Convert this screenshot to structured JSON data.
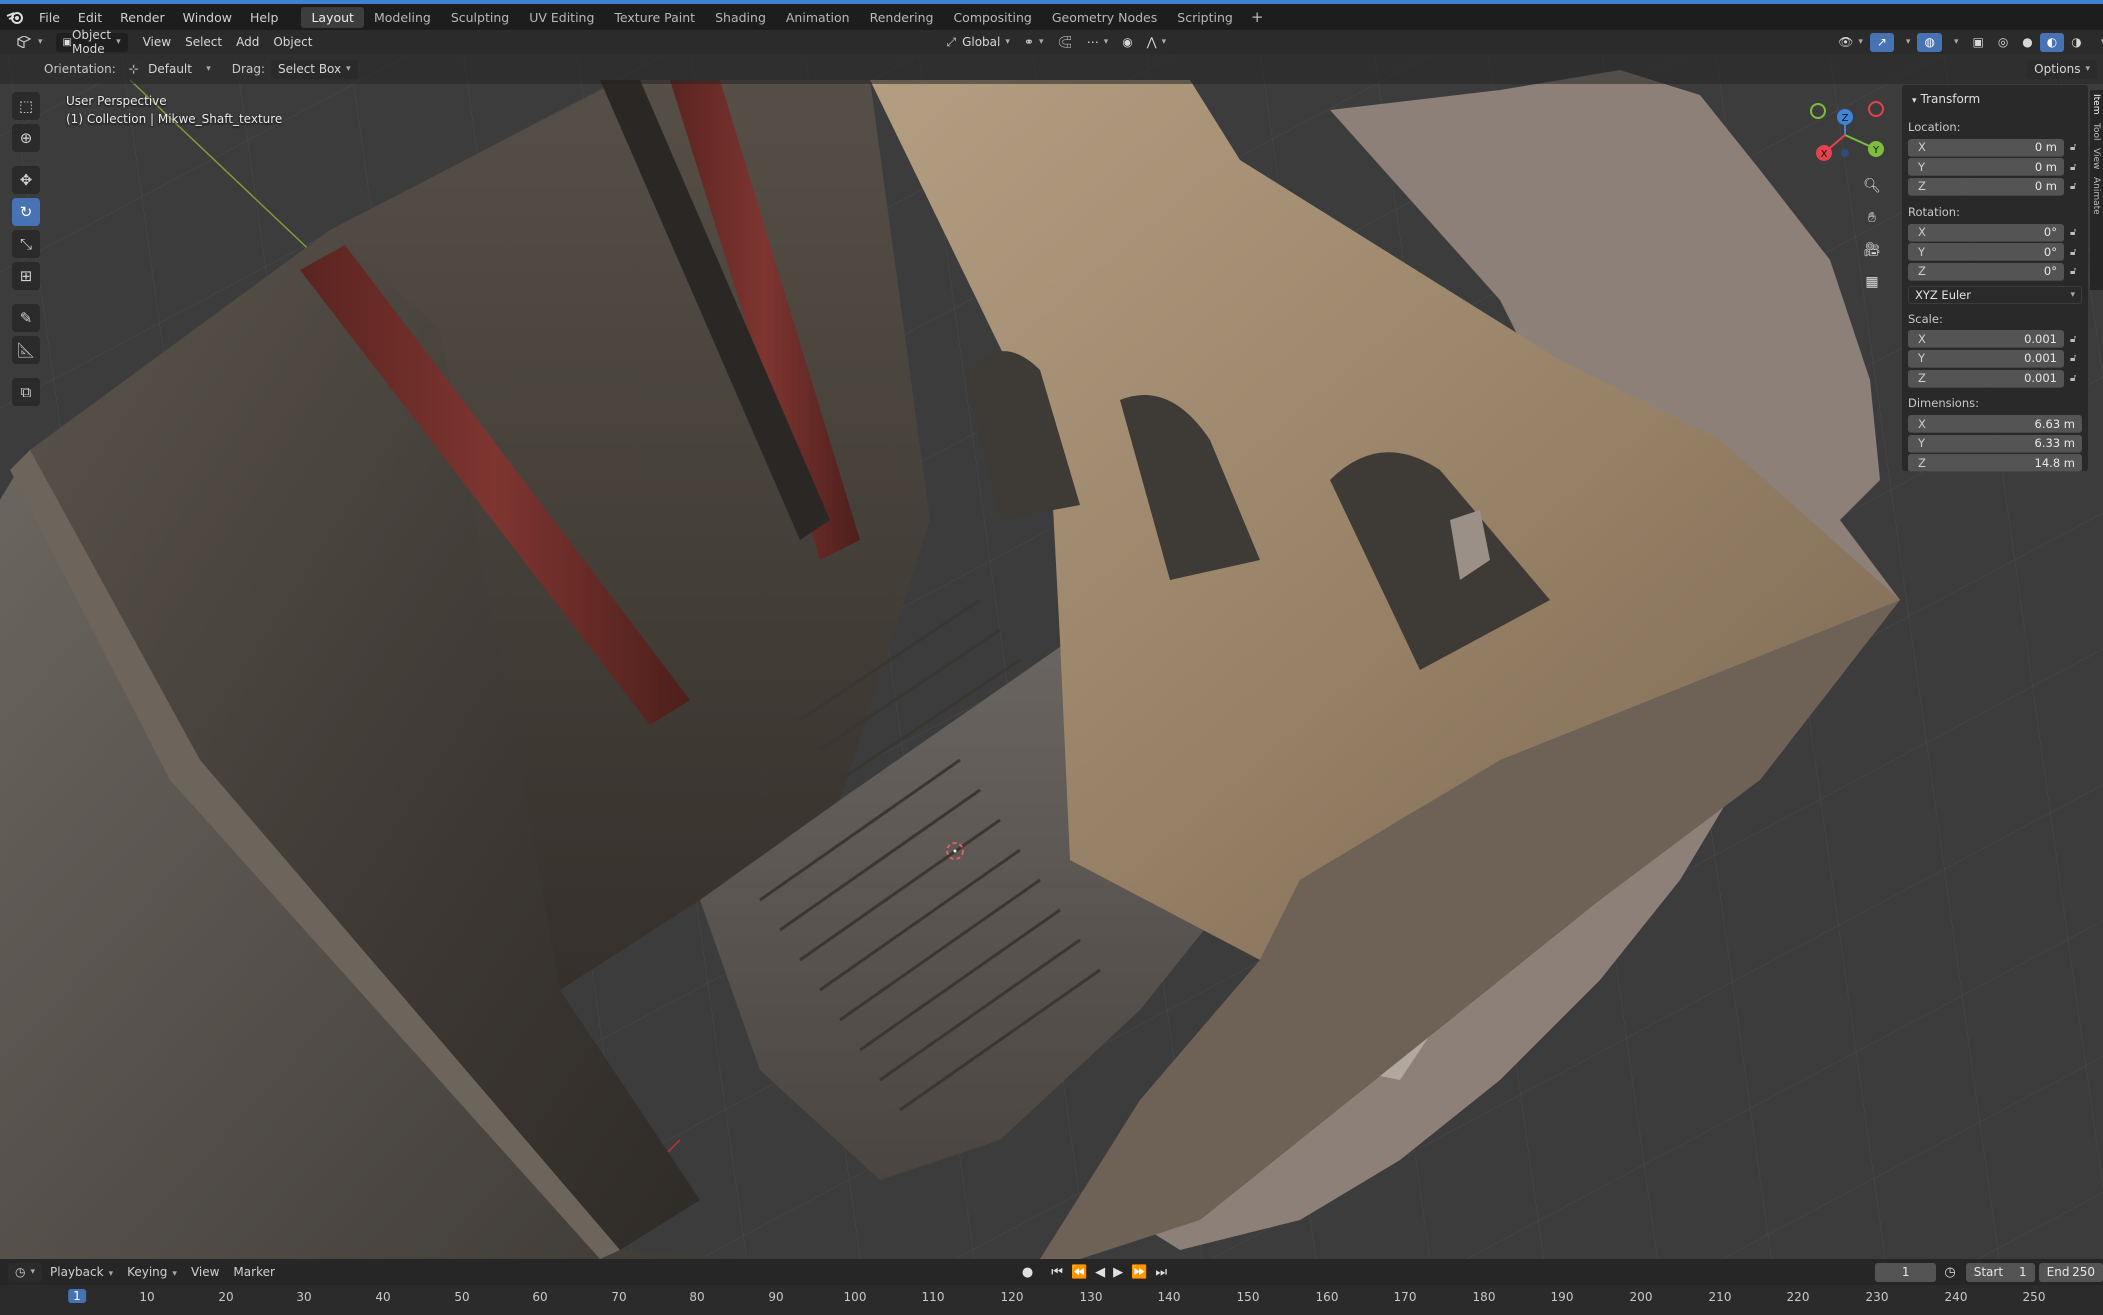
{
  "topbar": {
    "menu": [
      "File",
      "Edit",
      "Render",
      "Window",
      "Help"
    ],
    "workspaces": [
      "Layout",
      "Modeling",
      "Sculpting",
      "UV Editing",
      "Texture Paint",
      "Shading",
      "Animation",
      "Rendering",
      "Compositing",
      "Geometry Nodes",
      "Scripting"
    ],
    "active_workspace": "Layout",
    "add_workspace": "+"
  },
  "viewport_header": {
    "mode": "Object Mode",
    "menus": [
      "View",
      "Select",
      "Add",
      "Object"
    ],
    "transform_orientation": "Global",
    "options_label": "Options"
  },
  "tool_settings": {
    "orientation_label": "Orientation:",
    "orientation_value": "Default",
    "drag_label": "Drag:",
    "drag_value": "Select Box"
  },
  "viewport_info": {
    "view": "User Perspective",
    "collection": "(1) Collection | Mikwe_Shaft_texture"
  },
  "toolbar_icons": [
    "select-box-icon",
    "cursor-icon",
    "move-icon",
    "rotate-icon",
    "scale-icon",
    "transform-icon",
    "annotate-icon",
    "measure-icon",
    "add-cube-icon"
  ],
  "active_tool": "rotate-icon",
  "gizmo": {
    "x": "X",
    "y": "Y",
    "z": "Z",
    "x_color": "#e5424d",
    "y_color": "#7fbd3c",
    "z_color": "#3f84d6"
  },
  "sidebar_tabs": [
    "Item",
    "Tool",
    "View",
    "Animate"
  ],
  "transform_panel": {
    "title": "Transform",
    "location_label": "Location:",
    "location": [
      {
        "axis": "X",
        "value": "0 m"
      },
      {
        "axis": "Y",
        "value": "0 m"
      },
      {
        "axis": "Z",
        "value": "0 m"
      }
    ],
    "rotation_label": "Rotation:",
    "rotation": [
      {
        "axis": "X",
        "value": "0°"
      },
      {
        "axis": "Y",
        "value": "0°"
      },
      {
        "axis": "Z",
        "value": "0°"
      }
    ],
    "rotation_mode": "XYZ Euler",
    "scale_label": "Scale:",
    "scale": [
      {
        "axis": "X",
        "value": "0.001"
      },
      {
        "axis": "Y",
        "value": "0.001"
      },
      {
        "axis": "Z",
        "value": "0.001"
      }
    ],
    "dimensions_label": "Dimensions:",
    "dimensions": [
      {
        "axis": "X",
        "value": "6.63 m"
      },
      {
        "axis": "Y",
        "value": "6.33 m"
      },
      {
        "axis": "Z",
        "value": "14.8 m"
      }
    ]
  },
  "timeline": {
    "menus": [
      "Playback",
      "Keying",
      "View",
      "Marker"
    ],
    "current_frame": "1",
    "start_label": "Start",
    "start": "1",
    "end_label": "End",
    "end": "250",
    "ruler_labels": [
      "10",
      "20",
      "30",
      "40",
      "50",
      "60",
      "70",
      "80",
      "90",
      "100",
      "110",
      "120",
      "130",
      "140",
      "150",
      "160",
      "170",
      "180",
      "190",
      "200",
      "210",
      "220",
      "230",
      "240",
      "250"
    ],
    "current_frame_marker": "1"
  },
  "colors": {
    "accent": "#4772b3",
    "top_border": "#3f80d1",
    "axis_red": "#b8353b",
    "axis_green": "#8fb43a"
  }
}
